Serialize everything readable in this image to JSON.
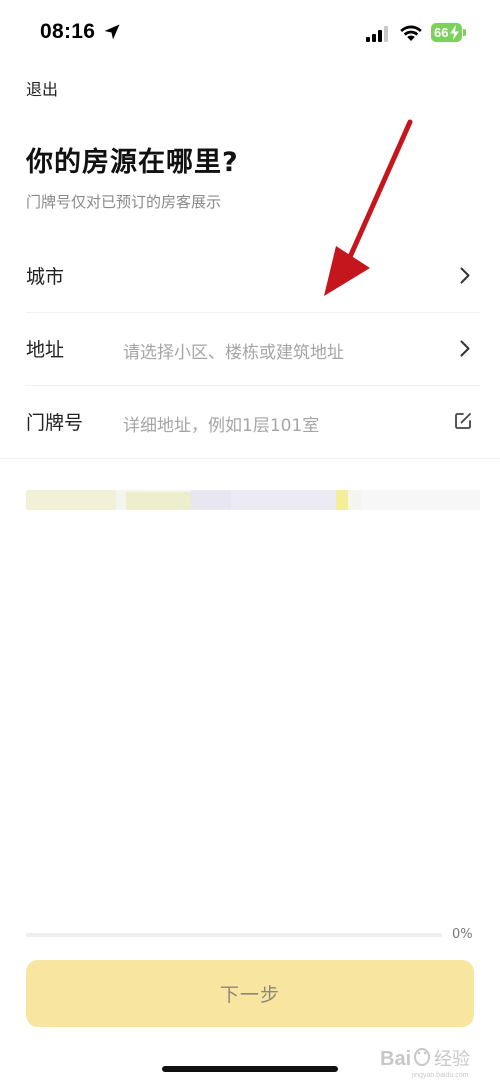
{
  "status_bar": {
    "time": "08:16",
    "battery": "66",
    "icons": [
      "location-arrow-icon",
      "cellular-signal-icon",
      "wifi-icon",
      "battery-icon"
    ]
  },
  "header": {
    "exit_label": "退出",
    "title": "你的房源在哪里?",
    "subtitle": "门牌号仅对已预订的房客展示"
  },
  "form": {
    "rows": [
      {
        "label": "城市",
        "placeholder": "",
        "trailing_icon": "chevron-right-icon"
      },
      {
        "label": "地址",
        "placeholder": "请选择小区、楼栋或建筑地址",
        "trailing_icon": "chevron-right-icon"
      },
      {
        "label": "门牌号",
        "placeholder": "详细地址，例如1层101室",
        "trailing_icon": "edit-icon"
      }
    ]
  },
  "progress": {
    "percent_label": "0%",
    "fraction": 0
  },
  "footer": {
    "next_label": "下一步"
  },
  "watermark": {
    "text": "Bai经验"
  },
  "colors": {
    "accent": "#f5cc3e",
    "button_bg": "#f8e6a0",
    "button_text": "#8d8778",
    "annotation_arrow": "#c4161c",
    "placeholder_text": "#a5a5a5"
  }
}
